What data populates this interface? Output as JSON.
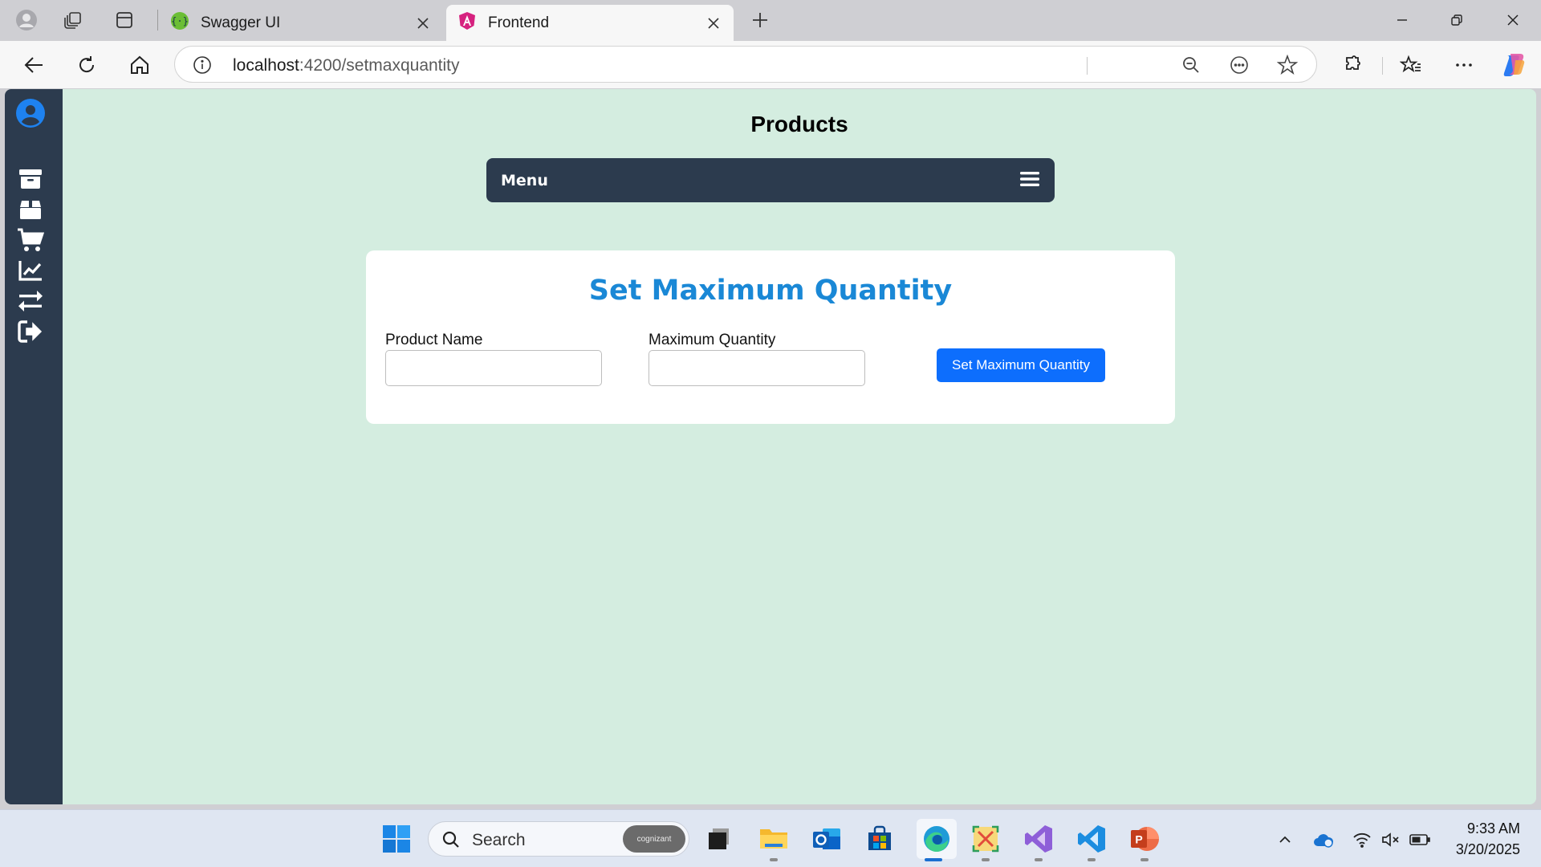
{
  "browser": {
    "tabs": [
      {
        "title": "Swagger UI",
        "active": false
      },
      {
        "title": "Frontend",
        "active": true
      }
    ],
    "address": {
      "host": "localhost",
      "path": ":4200/setmaxquantity"
    }
  },
  "page": {
    "title": "Products",
    "menu_label": "Menu",
    "sidebar_icons": [
      "user-circle-icon",
      "archive-icon",
      "box-icon",
      "cart-icon",
      "chart-line-icon",
      "transfer-icon",
      "logout-icon"
    ],
    "form": {
      "heading": "Set Maximum Quantity",
      "product_name_label": "Product Name",
      "product_name_value": "",
      "max_quantity_label": "Maximum Quantity",
      "max_quantity_value": "",
      "submit_label": "Set Maximum Quantity"
    },
    "colors": {
      "background": "#d4ede0",
      "sidebar": "#2c3b4e",
      "heading": "#1a88d6",
      "button": "#0d6efd"
    }
  },
  "taskbar": {
    "search_label": "Search",
    "search_badge": "cognizant",
    "time": "9:33 AM",
    "date": "3/20/2025"
  }
}
